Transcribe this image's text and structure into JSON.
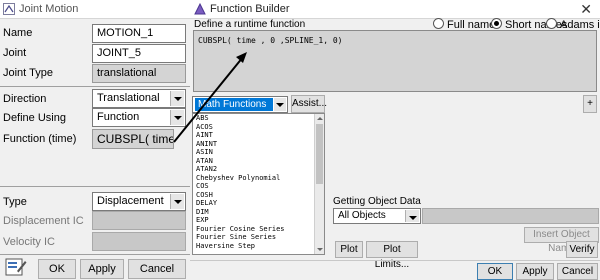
{
  "joint_motion": {
    "title": "Joint Motion",
    "fields": {
      "name_label": "Name",
      "name_value": "MOTION_1",
      "joint_label": "Joint",
      "joint_value": "JOINT_5",
      "joint_type_label": "Joint Type",
      "joint_type_value": "translational",
      "direction_label": "Direction",
      "direction_value": "Translational",
      "define_using_label": "Define Using",
      "define_using_value": "Function",
      "function_label": "Function (time)",
      "function_value": "CUBSPL( time ,",
      "type_label": "Type",
      "type_value": "Displacement",
      "displacement_ic_label": "Displacement IC",
      "velocity_ic_label": "Velocity IC"
    },
    "buttons": {
      "ok": "OK",
      "apply": "Apply",
      "cancel": "Cancel"
    }
  },
  "function_builder": {
    "title": "Function Builder",
    "close_glyph": "✕",
    "define_label": "Define a runtime function",
    "radios": {
      "full_names": "Full names",
      "short_names": "Short names",
      "adams_ids": "Adams ids",
      "selected": "short_names"
    },
    "expression": "CUBSPL( time , 0 ,SPLINE_1, 0)",
    "category": "Math Functions",
    "assist_label": "Assist...",
    "plus_label": "+",
    "functions": [
      "ABS",
      "ACOS",
      "AINT",
      "ANINT",
      "ASIN",
      "ATAN",
      "ATAN2",
      "Chebyshev Polynomial",
      "COS",
      "COSH",
      "DELAY",
      "DIM",
      "EXP",
      "Fourier Cosine Series",
      "Fourier Sine Series",
      "Haversine Step"
    ],
    "getting_object_data_label": "Getting Object Data",
    "object_filter": "All Objects",
    "insert_object_name": "Insert Object Name",
    "plot_label": "Plot",
    "plot_limits_label": "Plot Limits...",
    "verify_label": "Verify",
    "ok": "OK",
    "apply": "Apply",
    "cancel": "Cancel"
  },
  "colors": {
    "selection": "#0078d7",
    "default_button_border": "#3c7fb1",
    "readonly_field": "#d4d4d4"
  }
}
